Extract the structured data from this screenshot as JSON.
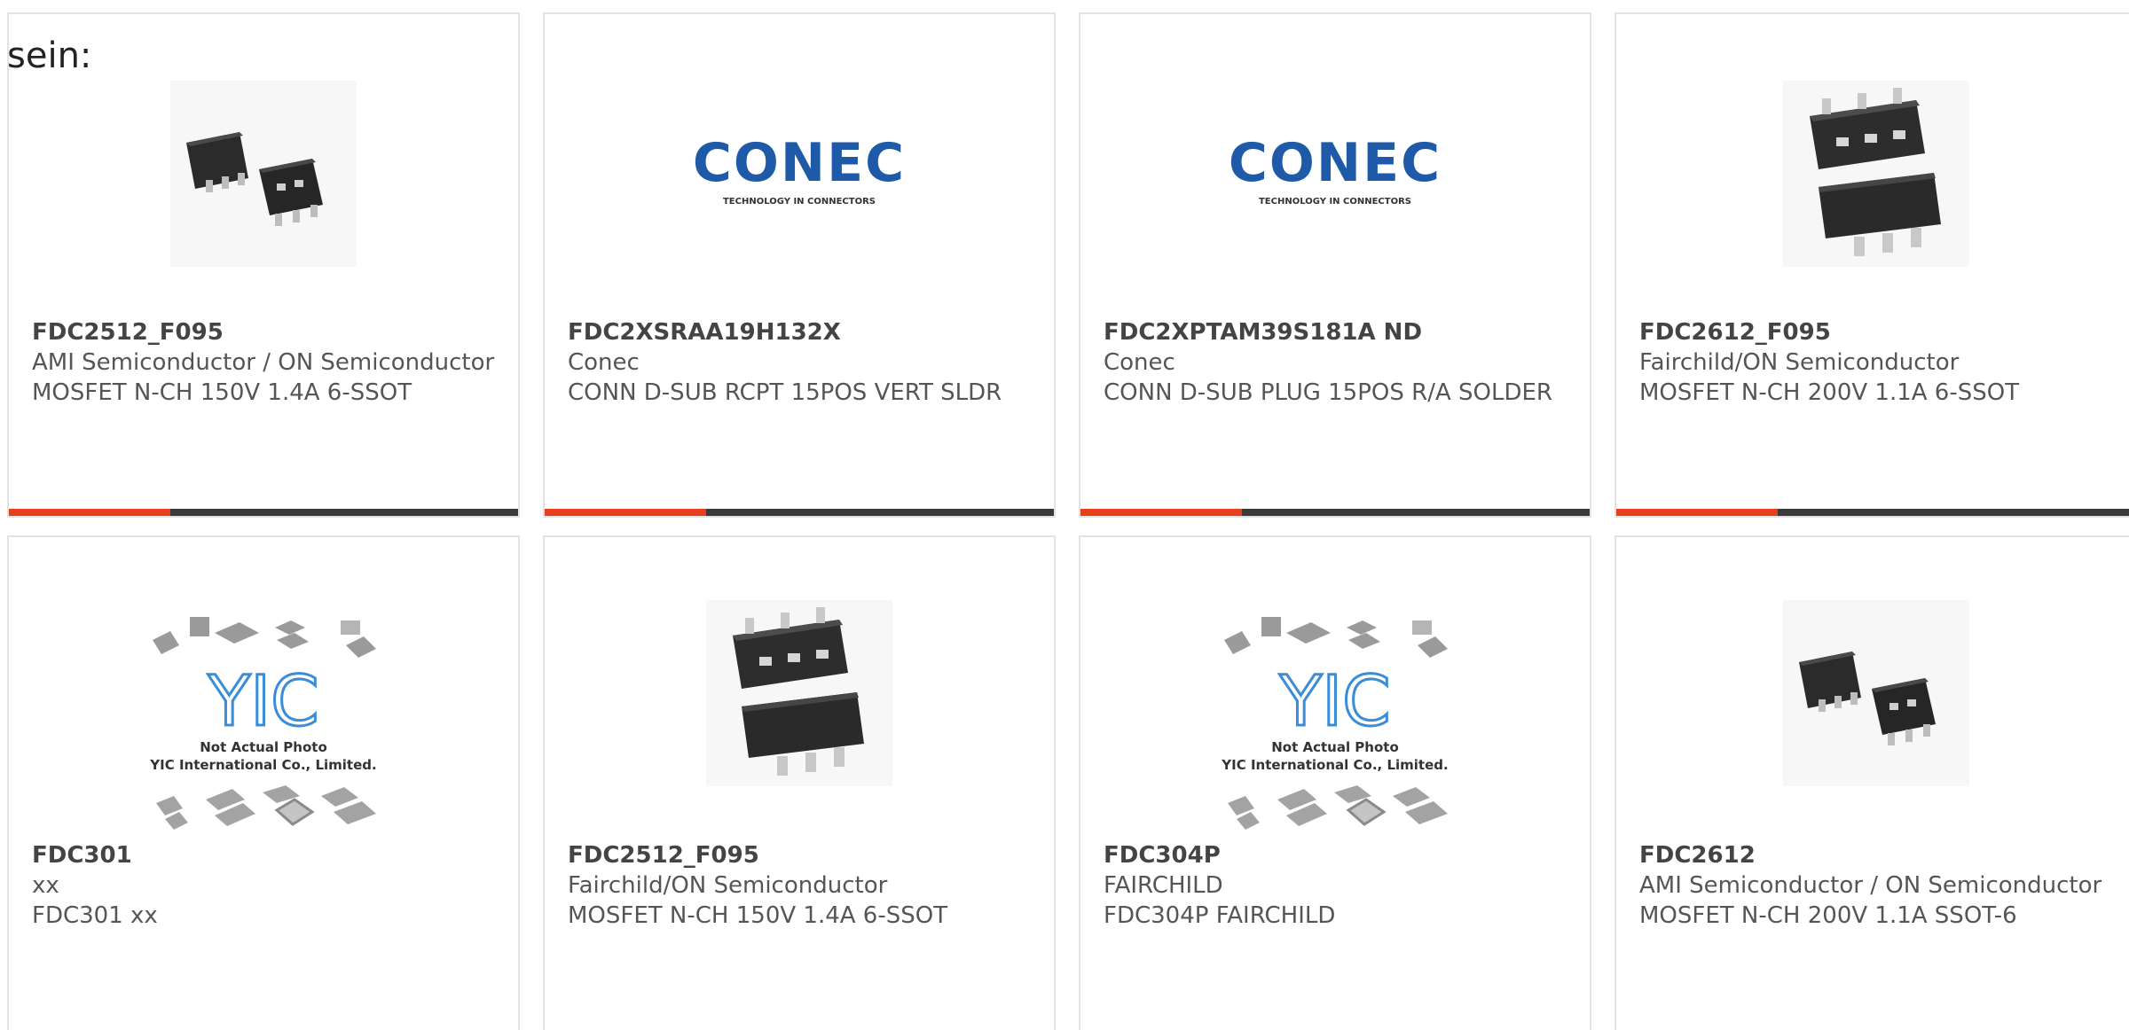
{
  "lead_text": "sein:",
  "colors": {
    "accent": "#e8401c",
    "bar": "#3a3a3a",
    "border": "#e3e3e3",
    "conec_blue": "#1f5aa8"
  },
  "logos": {
    "conec_word": "CONEC",
    "conec_tagline": "TECHNOLOGY IN CONNECTORS",
    "yic_mark": "YIC",
    "yic_line1": "Not Actual Photo",
    "yic_line2": "YIC International Co., Limited."
  },
  "products": [
    {
      "part": "FDC2512_F095",
      "mfr": "AMI Semiconductor / ON Semiconductor",
      "desc": "MOSFET N-CH 150V 1.4A 6-SSOT",
      "image": "sot6-pair-photo"
    },
    {
      "part": "FDC2XSRAA19H132X",
      "mfr": "Conec",
      "desc": "CONN D-SUB RCPT 15POS VERT SLDR",
      "image": "conec-logo"
    },
    {
      "part": "FDC2XPTAM39S181A ND",
      "mfr": "Conec",
      "desc": "CONN D-SUB PLUG 15POS R/A SOLDER",
      "image": "conec-logo"
    },
    {
      "part": "FDC2612_F095",
      "mfr": "Fairchild/ON Semiconductor",
      "desc": "MOSFET N-CH 200V 1.1A 6-SSOT",
      "image": "sot6-stack-photo"
    },
    {
      "part": "FDC301",
      "mfr": "xx",
      "desc": "FDC301 xx",
      "image": "yic-placeholder"
    },
    {
      "part": "FDC2512_F095",
      "mfr": "Fairchild/ON Semiconductor",
      "desc": "MOSFET N-CH 150V 1.4A 6-SSOT",
      "image": "sot6-stack-photo"
    },
    {
      "part": "FDC304P",
      "mfr": "FAIRCHILD",
      "desc": "FDC304P FAIRCHILD",
      "image": "yic-placeholder"
    },
    {
      "part": "FDC2612",
      "mfr": "AMI Semiconductor / ON Semiconductor",
      "desc": "MOSFET N-CH 200V 1.1A SSOT-6",
      "image": "sot6-pair-photo"
    }
  ]
}
